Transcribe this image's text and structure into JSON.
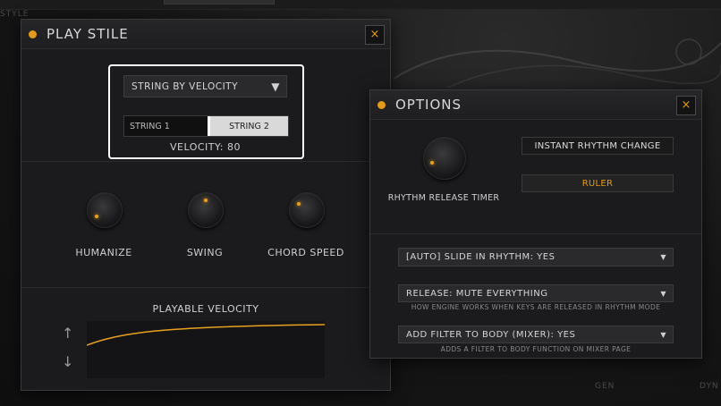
{
  "background": {
    "corner_label": "STYLE",
    "bottom_labels": [
      "GEN",
      "DYN"
    ]
  },
  "play_stile": {
    "title": "PLAY STILE",
    "close_glyph": "×",
    "mode_dropdown": {
      "value": "STRING BY VELOCITY",
      "arrow": "▼"
    },
    "string_toggle": {
      "options": [
        "STRING 1",
        "STRING 2"
      ],
      "selected": "STRING 2"
    },
    "velocity_readout": "VELOCITY: 80",
    "knobs": [
      {
        "label": "HUMANIZE"
      },
      {
        "label": "SWING"
      },
      {
        "label": "CHORD SPEED"
      }
    ],
    "playable_velocity": {
      "title": "PLAYABLE VELOCITY",
      "up_arrow": "↑",
      "down_arrow": "↓"
    }
  },
  "options": {
    "title": "OPTIONS",
    "close_glyph": "×",
    "rhythm_release_timer_label": "RHYTHM RELEASE TIMER",
    "instant_rhythm_change_label": "INSTANT RHYTHM CHANGE",
    "ruler_label": "RULER",
    "slide_in_rhythm": {
      "value": "[AUTO] SLIDE IN RHYTHM:  YES",
      "arrow": "▼"
    },
    "release": {
      "value": "RELEASE:  MUTE EVERYTHING",
      "arrow": "▼",
      "description": "HOW ENGINE WORKS WHEN KEYS ARE RELEASED IN RHYTHM MODE"
    },
    "add_filter": {
      "value": "ADD FILTER TO BODY (MIXER):  YES",
      "arrow": "▼",
      "description": "ADDS A FILTER TO BODY FUNCTION ON MIXER PAGE"
    }
  },
  "colors": {
    "accent": "#e39a1c",
    "panel": "#1b1b1d",
    "highlight_border": "#ffffff"
  }
}
